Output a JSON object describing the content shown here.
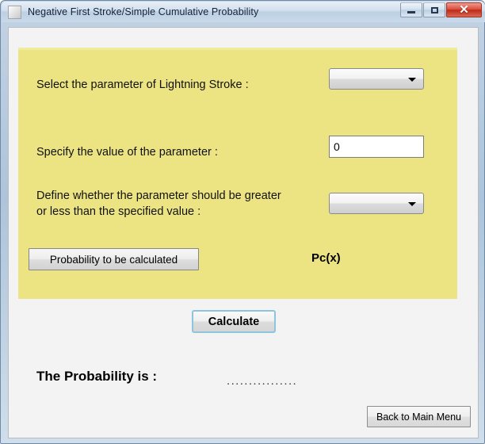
{
  "window": {
    "title": "Negative First Stroke/Simple Cumulative Probability",
    "icon": "app-icon",
    "controls": {
      "minimize_label": "–",
      "maximize_label": "□",
      "close_label": "✕"
    },
    "colors": {
      "panel_yellow": "#ECE483",
      "client_background": "#F4F3F4",
      "focus_border": "#8FC4DE",
      "close_button": "#D9503E"
    }
  },
  "form": {
    "select_parameter_label": "Select the parameter of Lightning Stroke :",
    "parameter_combo_value": "",
    "specify_value_label": "Specify the value of the parameter :",
    "parameter_value": "0",
    "define_compare_label": "Define whether the parameter should be greater\nor less than the specified value :",
    "compare_combo_value": "",
    "probability_button_label": "Probability to be calculated",
    "probability_notation": "Pc(x)"
  },
  "actions": {
    "calculate_label": "Calculate",
    "back_label": "Back to Main Menu"
  },
  "result": {
    "title": "The Probability is :",
    "value": "................"
  }
}
